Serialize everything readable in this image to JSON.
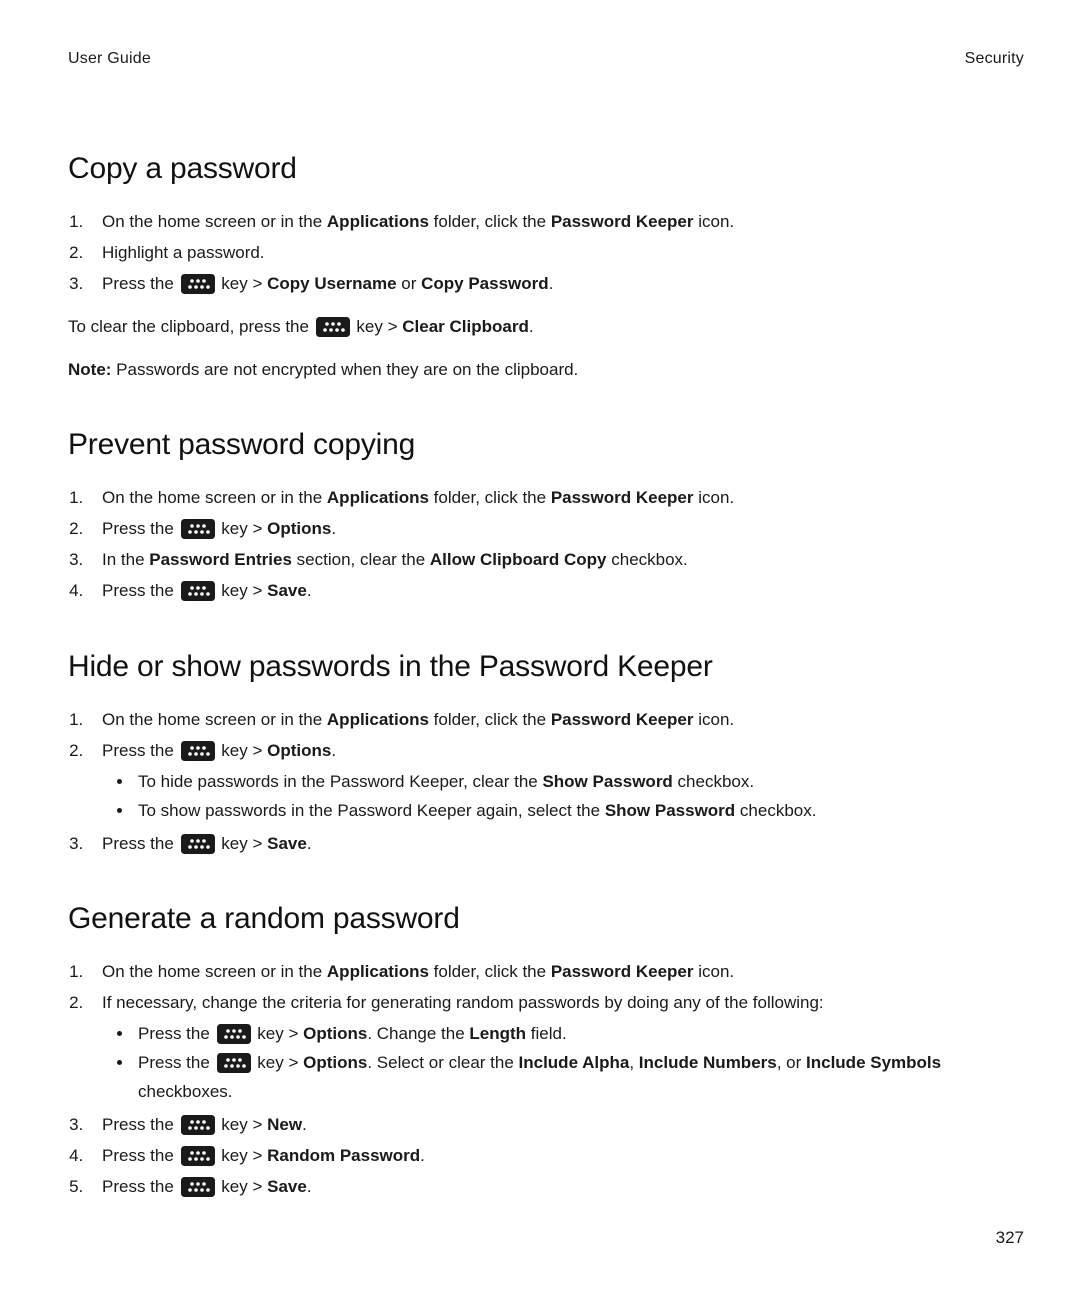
{
  "header": {
    "left": "User Guide",
    "right": "Security"
  },
  "page_number": "327",
  "sec1": {
    "heading": "Copy a password",
    "steps": [
      [
        {
          "t": "On the home screen or in the "
        },
        {
          "b": "Applications"
        },
        {
          "t": " folder, click the "
        },
        {
          "b": "Password Keeper"
        },
        {
          "t": " icon."
        }
      ],
      [
        {
          "t": "Highlight a password."
        }
      ],
      [
        {
          "t": "Press the "
        },
        {
          "icon": "menu-key"
        },
        {
          "t": " key > "
        },
        {
          "b": "Copy Username"
        },
        {
          "t": " or "
        },
        {
          "b": "Copy Password"
        },
        {
          "t": "."
        }
      ]
    ],
    "para1": [
      {
        "t": "To clear the clipboard, press the "
      },
      {
        "icon": "menu-key"
      },
      {
        "t": " key > "
      },
      {
        "b": "Clear Clipboard"
      },
      {
        "t": "."
      }
    ],
    "note": [
      {
        "b": "Note: "
      },
      {
        "t": "Passwords are not encrypted when they are on the clipboard."
      }
    ]
  },
  "sec2": {
    "heading": "Prevent password copying",
    "steps": [
      [
        {
          "t": "On the home screen or in the "
        },
        {
          "b": "Applications"
        },
        {
          "t": " folder, click the "
        },
        {
          "b": "Password Keeper"
        },
        {
          "t": " icon."
        }
      ],
      [
        {
          "t": "Press the "
        },
        {
          "icon": "menu-key"
        },
        {
          "t": " key > "
        },
        {
          "b": "Options"
        },
        {
          "t": "."
        }
      ],
      [
        {
          "t": "In the "
        },
        {
          "b": "Password Entries"
        },
        {
          "t": " section, clear the "
        },
        {
          "b": "Allow Clipboard Copy"
        },
        {
          "t": " checkbox."
        }
      ],
      [
        {
          "t": "Press the "
        },
        {
          "icon": "menu-key"
        },
        {
          "t": " key > "
        },
        {
          "b": "Save"
        },
        {
          "t": "."
        }
      ]
    ]
  },
  "sec3": {
    "heading": "Hide or show passwords in the Password Keeper",
    "steps": [
      [
        {
          "t": "On the home screen or in the "
        },
        {
          "b": "Applications"
        },
        {
          "t": " folder, click the "
        },
        {
          "b": "Password Keeper"
        },
        {
          "t": " icon."
        }
      ],
      [
        {
          "t": "Press the "
        },
        {
          "icon": "menu-key"
        },
        {
          "t": " key > "
        },
        {
          "b": "Options"
        },
        {
          "t": "."
        }
      ],
      [
        {
          "t": "Press the "
        },
        {
          "icon": "menu-key"
        },
        {
          "t": " key > "
        },
        {
          "b": "Save"
        },
        {
          "t": "."
        }
      ]
    ],
    "sub_after_step2": [
      [
        {
          "t": "To hide passwords in the Password Keeper, clear the "
        },
        {
          "b": "Show Password"
        },
        {
          "t": " checkbox."
        }
      ],
      [
        {
          "t": "To show passwords in the Password Keeper again, select the "
        },
        {
          "b": "Show Password"
        },
        {
          "t": " checkbox."
        }
      ]
    ]
  },
  "sec4": {
    "heading": "Generate a random password",
    "steps": [
      [
        {
          "t": "On the home screen or in the "
        },
        {
          "b": "Applications"
        },
        {
          "t": " folder, click the "
        },
        {
          "b": "Password Keeper"
        },
        {
          "t": " icon."
        }
      ],
      [
        {
          "t": "If necessary, change the criteria for generating random passwords by doing any of the following:"
        }
      ],
      [
        {
          "t": "Press the "
        },
        {
          "icon": "menu-key"
        },
        {
          "t": " key > "
        },
        {
          "b": "New"
        },
        {
          "t": "."
        }
      ],
      [
        {
          "t": "Press the "
        },
        {
          "icon": "menu-key"
        },
        {
          "t": " key > "
        },
        {
          "b": "Random Password"
        },
        {
          "t": "."
        }
      ],
      [
        {
          "t": "Press the "
        },
        {
          "icon": "menu-key"
        },
        {
          "t": " key > "
        },
        {
          "b": "Save"
        },
        {
          "t": "."
        }
      ]
    ],
    "sub_after_step2": [
      [
        {
          "t": "Press the "
        },
        {
          "icon": "menu-key"
        },
        {
          "t": " key > "
        },
        {
          "b": "Options"
        },
        {
          "t": ". Change the "
        },
        {
          "b": "Length"
        },
        {
          "t": " field."
        }
      ],
      [
        {
          "t": "Press the "
        },
        {
          "icon": "menu-key"
        },
        {
          "t": " key > "
        },
        {
          "b": "Options"
        },
        {
          "t": ". Select or clear the "
        },
        {
          "b": "Include Alpha"
        },
        {
          "t": ", "
        },
        {
          "b": "Include Numbers"
        },
        {
          "t": ", or "
        },
        {
          "b": "Include Symbols"
        },
        {
          "t": " checkboxes."
        }
      ]
    ]
  }
}
